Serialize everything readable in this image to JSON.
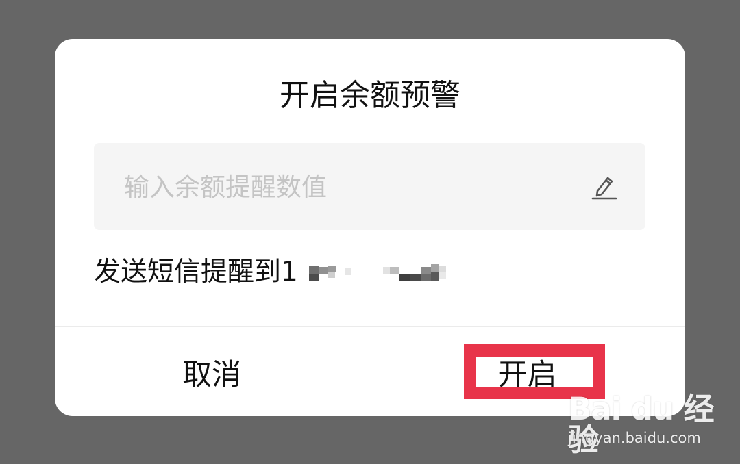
{
  "dialog": {
    "title": "开启余额预警",
    "amount_input": {
      "value": "",
      "placeholder": "输入余额提醒数值"
    },
    "sms_label": "发送短信提醒到1",
    "cancel_label": "取消",
    "confirm_label": "开启"
  },
  "colors": {
    "overlay": "#666666",
    "highlight_border": "#e8344a"
  },
  "icons": {
    "edit": "pencil-edit-icon"
  },
  "watermark": {
    "logo_text": "Bai du 经验",
    "site": "jingyan.baidu.com"
  }
}
